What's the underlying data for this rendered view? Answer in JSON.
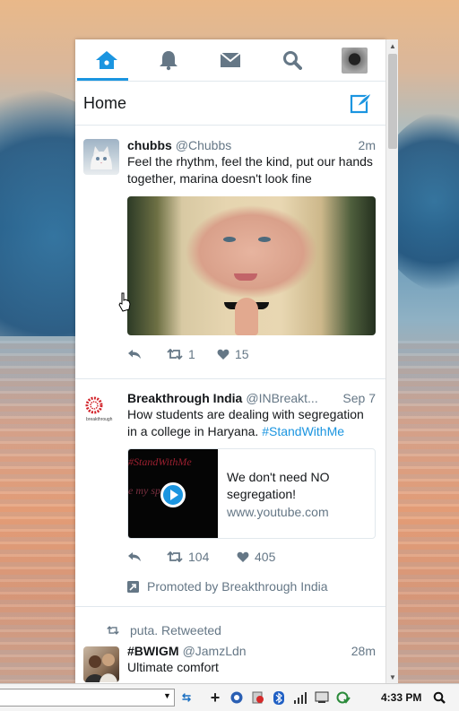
{
  "nav": {
    "tabs": [
      {
        "icon": "home-icon",
        "active": true
      },
      {
        "icon": "bell-icon",
        "active": false
      },
      {
        "icon": "envelope-icon",
        "active": false
      },
      {
        "icon": "search-icon",
        "active": false
      },
      {
        "icon": "profile-avatar",
        "active": false
      }
    ]
  },
  "header": {
    "title": "Home",
    "compose_icon": "compose-tweet-icon"
  },
  "tweets": [
    {
      "name": "chubbs",
      "handle": "@Chubbs",
      "time": "2m",
      "text": "Feel the rhythm, feel the kind, put our hands together, marina  doesn't look fine",
      "retweets": "1",
      "likes": "15"
    },
    {
      "name": "Breakthrough India",
      "handle": "@INBreakt...",
      "time": "Sep 7",
      "text": "How students are dealing with segregation in a college in Haryana. ",
      "hashtag": "#StandWithMe",
      "card": {
        "thumb_line1": "#StandWithMe",
        "thumb_line2": "e my     space",
        "title": "We don't need NO segregation!",
        "domain": "www.youtube.com"
      },
      "retweets": "104",
      "likes": "405",
      "promoted": "Promoted by Breakthrough India",
      "avatar_text": "breakthrough"
    },
    {
      "retweeted_by": "puta. Retweeted",
      "name": "#BWIGM",
      "handle": "@JamzLdn",
      "time": "28m",
      "text": "Ultimate comfort"
    }
  ],
  "taskbar": {
    "clock": "4:33 PM"
  },
  "colors": {
    "accent": "#1b95e0",
    "text": "#14171a",
    "muted": "#657786"
  }
}
